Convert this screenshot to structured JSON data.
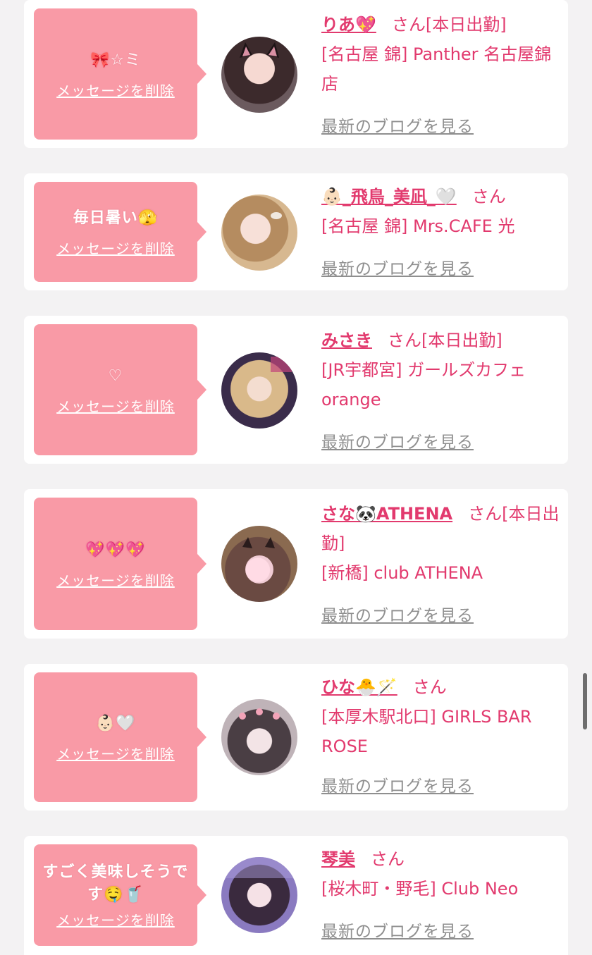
{
  "delete_label": "メッセージを削除",
  "blog_label": "最新のブログを見る",
  "san_label": "さん",
  "colors": {
    "page_bg": "#f3f2f3",
    "bubble_pink": "#f99aa6",
    "accent_pink": "#e23a6e",
    "link_gray": "#8f8f8f"
  },
  "items": [
    {
      "message": "🎀☆ミ",
      "name": "りあ💖",
      "status": "[本日出勤]",
      "shop": "[名古屋 錦] Panther 名古屋錦店",
      "avatar_icon": "girl-cat-ears-photo"
    },
    {
      "message": "毎日暑い🫣",
      "name": "👶🏻_飛鳥_美凪_🤍",
      "status": "",
      "shop": "[名古屋 錦] Mrs.CAFE 光",
      "avatar_icon": "girl-photo"
    },
    {
      "message": "♡",
      "name": "みさき",
      "status": "[本日出勤]",
      "shop": "[JR宇都宮] ガールズカフェ orange",
      "avatar_icon": "girl-photo"
    },
    {
      "message": "💖💖💖",
      "name": "さな🐼ATHENA",
      "status": "[本日出勤]",
      "shop": "[新橋] club ATHENA",
      "avatar_icon": "girl-photo-blurred-face"
    },
    {
      "message": "👶🏻🤍",
      "name": "ひな🐣🪄",
      "status": "",
      "shop": "[本厚木駅北口] GIRLS BAR ROSE",
      "avatar_icon": "girl-photo"
    },
    {
      "message": "すごく美味しそうです🤤🥤",
      "name": "琴美",
      "status": "",
      "shop": "[桜木町・野毛] Club Neo",
      "avatar_icon": "girl-photo"
    }
  ]
}
